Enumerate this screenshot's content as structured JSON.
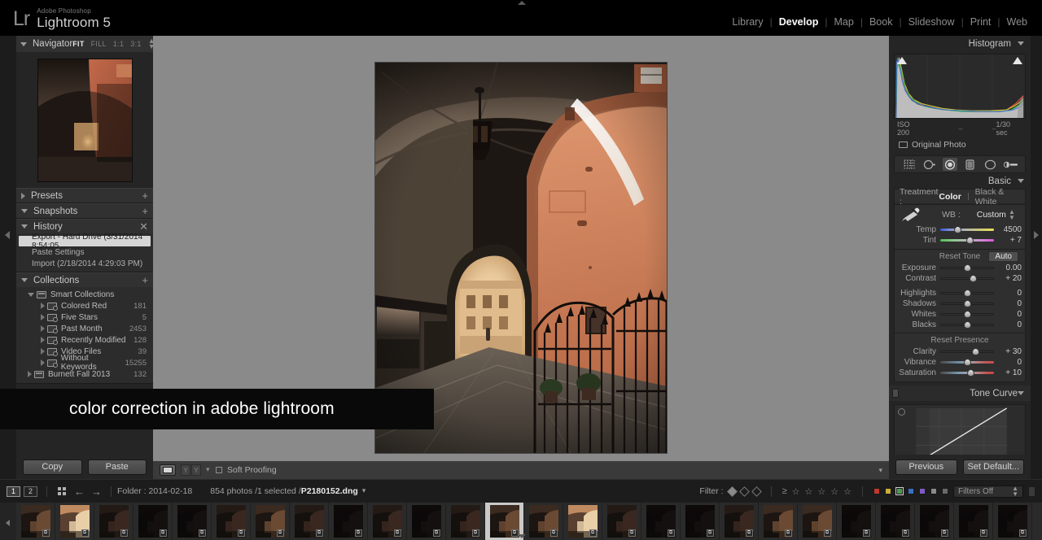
{
  "app": {
    "brand_pre": "Adobe Photoshop",
    "brand_name": "Lightroom 5",
    "logo": "Lr"
  },
  "modules": [
    {
      "label": "Library",
      "active": false
    },
    {
      "label": "Develop",
      "active": true
    },
    {
      "label": "Map",
      "active": false
    },
    {
      "label": "Book",
      "active": false
    },
    {
      "label": "Slideshow",
      "active": false
    },
    {
      "label": "Print",
      "active": false
    },
    {
      "label": "Web",
      "active": false
    }
  ],
  "navigator": {
    "title": "Navigator",
    "zoom_levels": [
      "FIT",
      "FILL",
      "1:1",
      "3:1"
    ],
    "active_zoom": "FIT"
  },
  "left_sections": [
    {
      "title": "Presets",
      "expanded": false,
      "plus": "+"
    },
    {
      "title": "Snapshots",
      "expanded": true,
      "plus": "+"
    },
    {
      "title": "History",
      "expanded": true,
      "plus": "✕"
    }
  ],
  "history": {
    "title": "History",
    "items": [
      {
        "label": "Export - Hard Drive (3/31/2014 8:54:05 ...",
        "selected": true
      },
      {
        "label": "Paste Settings",
        "selected": false
      },
      {
        "label": "Import (2/18/2014 4:29:03 PM)",
        "selected": false
      }
    ]
  },
  "collections": {
    "title": "Collections",
    "plus": "+",
    "group_label": "Smart Collections",
    "items": [
      {
        "label": "Colored Red",
        "count": "181"
      },
      {
        "label": "Five Stars",
        "count": "5"
      },
      {
        "label": "Past Month",
        "count": "2453"
      },
      {
        "label": "Recently Modified",
        "count": "128"
      },
      {
        "label": "Video Files",
        "count": "39"
      },
      {
        "label": "Without Keywords",
        "count": "15255"
      }
    ],
    "extra": {
      "label": "Burnett Fall 2013",
      "count": "132"
    }
  },
  "left_buttons": {
    "copy": "Copy",
    "paste": "Paste"
  },
  "histogram": {
    "title": "Histogram",
    "iso": "ISO 200",
    "focal": "–",
    "aperture": "–",
    "shutter": "1/30 sec",
    "original_photo": "Original Photo"
  },
  "tools": [
    {
      "name": "crop-overlay-tool",
      "active": false
    },
    {
      "name": "spot-removal-tool",
      "active": false
    },
    {
      "name": "red-eye-tool",
      "active": true
    },
    {
      "name": "graduated-filter-tool",
      "active": false
    },
    {
      "name": "radial-filter-tool",
      "active": false
    },
    {
      "name": "adjustment-brush-tool",
      "active": false
    }
  ],
  "basic": {
    "title": "Basic",
    "treatment_label": "Treatment :",
    "treatment_color": "Color",
    "treatment_bw": "Black & White",
    "wb_label": "WB :",
    "wb_value": "Custom",
    "reset_tone": "Reset Tone",
    "auto": "Auto",
    "reset_presence": "Reset Presence",
    "wb_sliders": [
      {
        "name": "Temp",
        "value": "4500",
        "pos": 32,
        "track": "temp"
      },
      {
        "name": "Tint",
        "value": "+ 7",
        "pos": 54,
        "track": "tint"
      }
    ],
    "tone_sliders": [
      {
        "name": "Exposure",
        "value": "0.00",
        "pos": 50,
        "track": "plain"
      },
      {
        "name": "Contrast",
        "value": "+ 20",
        "pos": 60,
        "track": "plain"
      },
      {
        "name": "Highlights",
        "value": "0",
        "pos": 50,
        "track": "plain"
      },
      {
        "name": "Shadows",
        "value": "0",
        "pos": 50,
        "track": "plain"
      },
      {
        "name": "Whites",
        "value": "0",
        "pos": 50,
        "track": "plain"
      },
      {
        "name": "Blacks",
        "value": "0",
        "pos": 50,
        "track": "plain"
      }
    ],
    "presence_sliders": [
      {
        "name": "Clarity",
        "value": "+ 30",
        "pos": 65,
        "track": "plain"
      },
      {
        "name": "Vibrance",
        "value": "0",
        "pos": 50,
        "track": "vib"
      },
      {
        "name": "Saturation",
        "value": "+ 10",
        "pos": 56,
        "track": "sat"
      }
    ]
  },
  "tone_curve": {
    "title": "Tone Curve"
  },
  "right_buttons": {
    "previous": "Previous",
    "set_default": "Set Default..."
  },
  "center_toolbar": {
    "soft_proofing": "Soft Proofing",
    "compare_y": "Y",
    "compare_y2": "Y"
  },
  "caption": {
    "text": "color correction in adobe lightroom"
  },
  "filmstrip_bar": {
    "screen1": "1",
    "screen2": "2",
    "folder": "Folder : 2014-02-18",
    "photo_info_count": "854 photos /1 selected /",
    "photo_name": "P2180152.dng",
    "filter_label": "Filter :",
    "filters_off": "Filters Off",
    "stars": [
      "☆",
      "☆",
      "☆",
      "☆",
      "☆"
    ],
    "ge": "≥",
    "label_colors": [
      "#c0392b",
      "#c9b037",
      "#4d9b4d",
      "#3a6fc4",
      "#7d5bbf",
      "#8a8a8a",
      "#6a6a6a"
    ]
  },
  "filmstrip": {
    "badge": "⧉",
    "thumbs": [
      {
        "id": "t1",
        "tone": "dim",
        "selected": false
      },
      {
        "id": "t2",
        "tone": "bright",
        "selected": false
      },
      {
        "id": "t3",
        "tone": "dark",
        "selected": false
      },
      {
        "id": "t4",
        "tone": "black",
        "selected": false
      },
      {
        "id": "t5",
        "tone": "black",
        "selected": false
      },
      {
        "id": "t6",
        "tone": "dark",
        "selected": false
      },
      {
        "id": "t7",
        "tone": "dim",
        "selected": false
      },
      {
        "id": "t8",
        "tone": "dark",
        "selected": false
      },
      {
        "id": "t9",
        "tone": "black",
        "selected": false
      },
      {
        "id": "t10",
        "tone": "dark",
        "selected": false
      },
      {
        "id": "t11",
        "tone": "black",
        "selected": false
      },
      {
        "id": "t12",
        "tone": "dark",
        "selected": false
      },
      {
        "id": "t13",
        "tone": "dim",
        "selected": true
      },
      {
        "id": "t14",
        "tone": "dim",
        "selected": false
      },
      {
        "id": "t15",
        "tone": "bright",
        "selected": false
      },
      {
        "id": "t16",
        "tone": "dark",
        "selected": false
      },
      {
        "id": "t17",
        "tone": "black",
        "selected": false
      },
      {
        "id": "t18",
        "tone": "black",
        "selected": false
      },
      {
        "id": "t19",
        "tone": "dark",
        "selected": false
      },
      {
        "id": "t20",
        "tone": "dim",
        "selected": false
      },
      {
        "id": "t21",
        "tone": "dim",
        "selected": false
      },
      {
        "id": "t22",
        "tone": "black",
        "selected": false
      },
      {
        "id": "t23",
        "tone": "black",
        "selected": false
      },
      {
        "id": "t24",
        "tone": "black",
        "selected": false
      },
      {
        "id": "t25",
        "tone": "black",
        "selected": false
      },
      {
        "id": "t26",
        "tone": "black",
        "selected": false
      }
    ]
  }
}
